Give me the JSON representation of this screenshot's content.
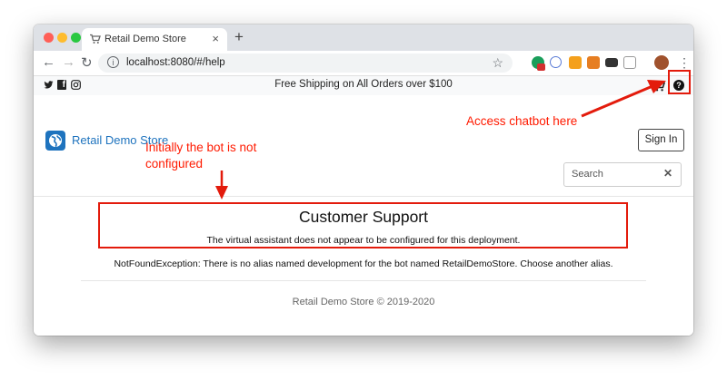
{
  "browser": {
    "tab_title": "Retail Demo Store",
    "tab_close": "×",
    "new_tab": "+",
    "url": "localhost:8080/#/help",
    "nav": {
      "back": "←",
      "forward": "→",
      "reload": "↻"
    },
    "star": "☆",
    "menu": "⋮",
    "traffic_lights": {
      "close": "#ff5f57",
      "minimize": "#febc2e",
      "maximize": "#28c840"
    }
  },
  "site": {
    "shipping_text": "Free Shipping on All Orders over $100",
    "social": {
      "twitter": "🐦",
      "facebook": "f",
      "instagram": "◎"
    },
    "brand_name": "Retail Demo Store",
    "signin_label": "Sign In",
    "search_placeholder": "Search",
    "search_clear": "✕",
    "help_glyph": "?",
    "cart_glyph": "🛒"
  },
  "content": {
    "heading": "Customer Support",
    "message_1": "The virtual assistant does not appear to be configured for this deployment.",
    "message_2": "NotFoundException: There is no alias named development for the bot named RetailDemoStore. Choose another alias.",
    "footer": "Retail Demo Store © 2019-2020"
  },
  "annotations": {
    "chatbot_label": "Access chatbot here",
    "not_configured_line1": "Initially the bot is not",
    "not_configured_line2": "configured",
    "color": "#ff1a00"
  }
}
